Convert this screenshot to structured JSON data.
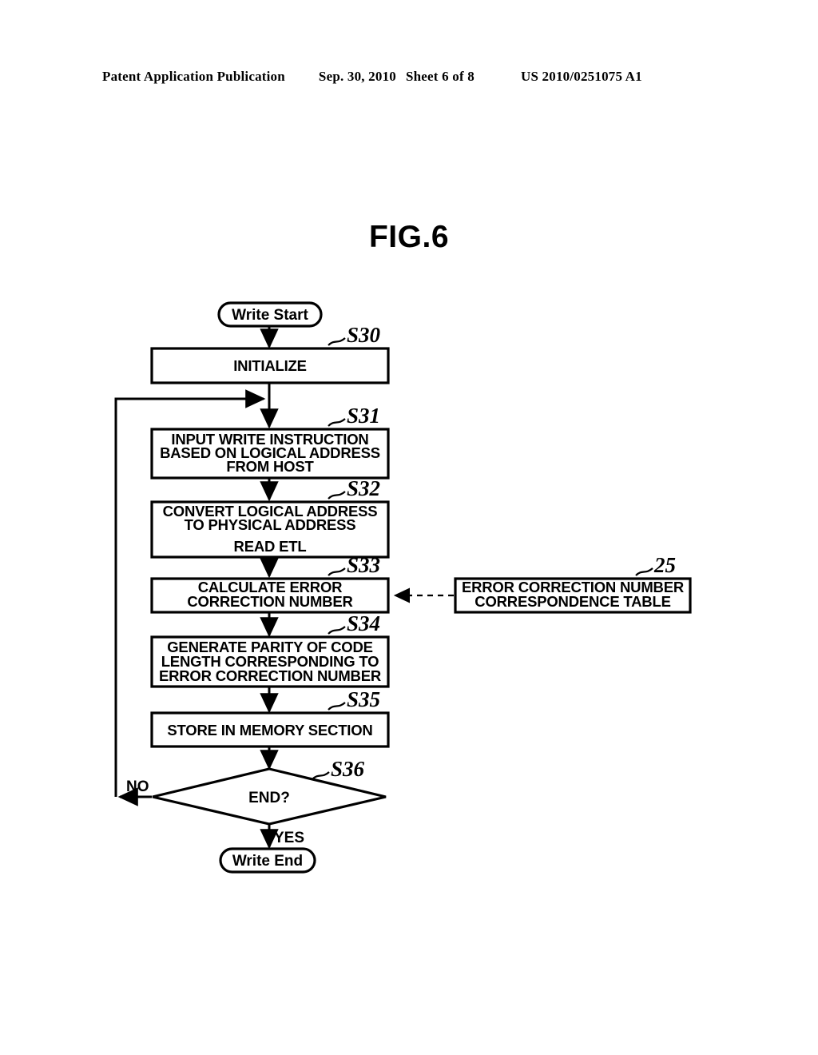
{
  "header": {
    "publication": "Patent Application Publication",
    "date": "Sep. 30, 2010",
    "sheet": "Sheet 6 of 8",
    "patent_number": "US 2010/0251075 A1"
  },
  "figure": {
    "title": "FIG.6"
  },
  "flowchart": {
    "start_terminal": "Write Start",
    "end_terminal": "Write End",
    "steps": [
      {
        "id": "S30",
        "label": "S30",
        "lines": [
          "INITIALIZE"
        ]
      },
      {
        "id": "S31",
        "label": "S31",
        "lines": [
          "INPUT WRITE INSTRUCTION",
          "BASED ON LOGICAL ADDRESS",
          "FROM HOST"
        ]
      },
      {
        "id": "S32",
        "label": "S32",
        "lines": [
          "CONVERT LOGICAL ADDRESS",
          "TO PHYSICAL ADDRESS",
          "",
          "READ ETL"
        ]
      },
      {
        "id": "S33",
        "label": "S33",
        "lines": [
          "CALCULATE ERROR",
          "CORRECTION NUMBER"
        ]
      },
      {
        "id": "S34",
        "label": "S34",
        "lines": [
          "GENERATE PARITY OF CODE",
          "LENGTH CORRESPONDING TO",
          "ERROR CORRECTION NUMBER"
        ]
      },
      {
        "id": "S35",
        "label": "S35",
        "lines": [
          "STORE IN MEMORY SECTION"
        ]
      }
    ],
    "decision": {
      "id": "S36",
      "label": "S36",
      "text": "END?",
      "branch_no": "NO",
      "branch_yes": "YES"
    },
    "reference_block": {
      "label": "25",
      "lines": [
        "ERROR CORRECTION NUMBER",
        "CORRESPONDENCE TABLE"
      ]
    }
  },
  "colors": {
    "ink": "#000000",
    "paper": "#ffffff"
  }
}
